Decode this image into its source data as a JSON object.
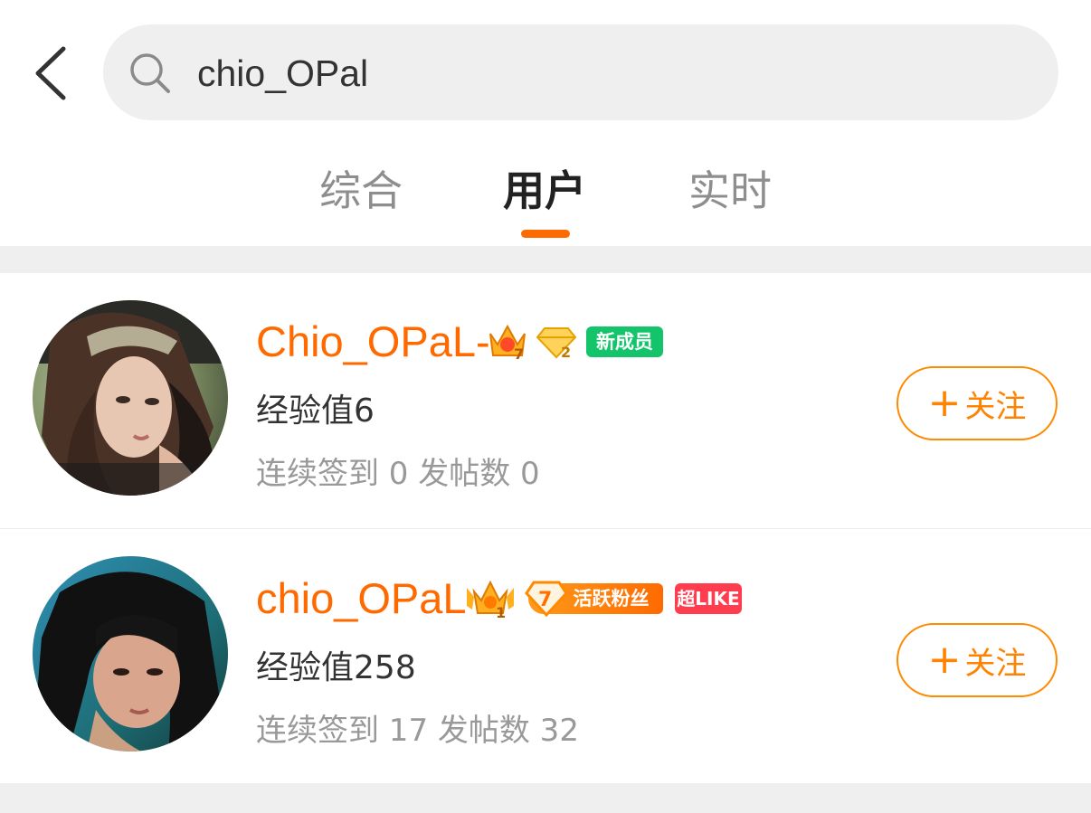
{
  "search": {
    "query": "chio_OPal"
  },
  "tabs": [
    {
      "label": "综合",
      "active": false
    },
    {
      "label": "用户",
      "active": true
    },
    {
      "label": "实时",
      "active": false
    }
  ],
  "colors": {
    "accent": "#ff6a00",
    "new_member_badge": "#13c46b",
    "super_like_badge": "#ff3d4f"
  },
  "users": [
    {
      "name": "Chio_OPaL-",
      "exp_label": "经验值",
      "exp_value": "6",
      "stats_text": "连续签到 0 发帖数 0",
      "crown_level": "7",
      "diamond_level": "2",
      "badge_label": "新成员",
      "follow_label": "关注"
    },
    {
      "name": "chio_OPaL",
      "exp_label": "经验值",
      "exp_value": "258",
      "stats_text": "连续签到 17 发帖数 32",
      "crown_level": "1",
      "fan_level": "7",
      "fan_label": "活跃粉丝",
      "super_like_label": "超LIKE",
      "follow_label": "关注"
    }
  ]
}
